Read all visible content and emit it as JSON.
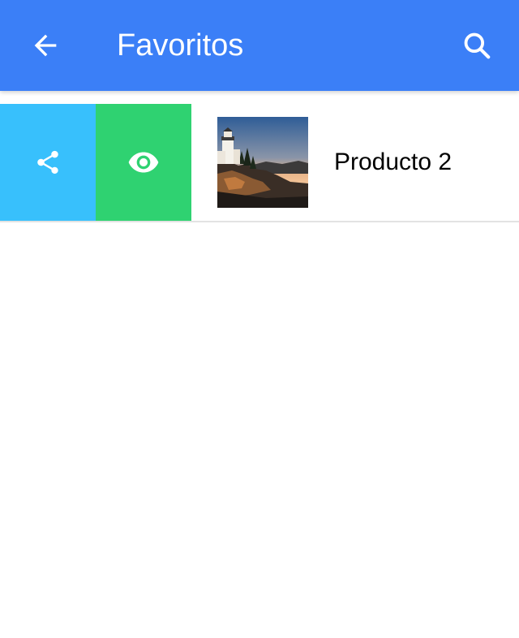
{
  "header": {
    "title": "Favoritos",
    "back_icon": "arrow-back-icon",
    "search_icon": "search-icon",
    "color": "#3b7ff7"
  },
  "favorites": [
    {
      "name": "Producto 2",
      "thumbnail": "lighthouse-photo",
      "options": [
        {
          "icon": "share-icon",
          "color": "#38c0fc"
        },
        {
          "icon": "eye-icon",
          "color": "#2fd271"
        }
      ]
    }
  ]
}
